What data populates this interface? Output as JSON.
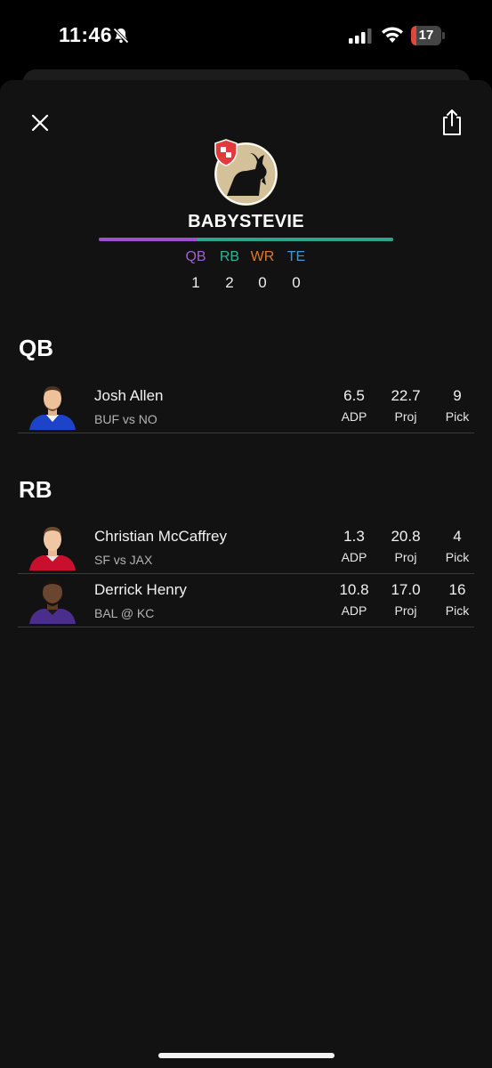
{
  "status_bar": {
    "time": "11:46",
    "battery_level": "17",
    "icons": [
      "bell-slash-icon",
      "cellular-signal-icon",
      "wifi-icon",
      "battery-icon"
    ]
  },
  "header": {
    "close_icon": "close-icon",
    "share_icon": "share-icon",
    "team_name": "BABYSTEVIE",
    "avatar_icon": "goat-avatar",
    "badge_icon": "shield-badge-icon",
    "progress_colors": [
      "#9c4fd1",
      "#2aa58e"
    ],
    "positions": [
      {
        "label": "QB",
        "count": "1",
        "color": "#a35ed6"
      },
      {
        "label": "RB",
        "count": "2",
        "color": "#2bb59a"
      },
      {
        "label": "WR",
        "count": "0",
        "color": "#e07a2c"
      },
      {
        "label": "TE",
        "count": "0",
        "color": "#3f97d6"
      }
    ]
  },
  "sections": [
    {
      "title": "QB",
      "players": [
        {
          "name": "Josh Allen",
          "matchup": "BUF vs NO",
          "adp": "6.5",
          "adp_label": "ADP",
          "proj": "22.7",
          "proj_label": "Proj",
          "pick": "9",
          "pick_label": "Pick",
          "jersey_color": "#1d44c8"
        }
      ]
    },
    {
      "title": "RB",
      "players": [
        {
          "name": "Christian McCaffrey",
          "matchup": "SF vs JAX",
          "adp": "1.3",
          "adp_label": "ADP",
          "proj": "20.8",
          "proj_label": "Proj",
          "pick": "4",
          "pick_label": "Pick",
          "jersey_color": "#c8102e"
        },
        {
          "name": "Derrick Henry",
          "matchup": "BAL @ KC",
          "adp": "10.8",
          "adp_label": "ADP",
          "proj": "17.0",
          "proj_label": "Proj",
          "pick": "16",
          "pick_label": "Pick",
          "jersey_color": "#4b2d8c"
        }
      ]
    }
  ]
}
